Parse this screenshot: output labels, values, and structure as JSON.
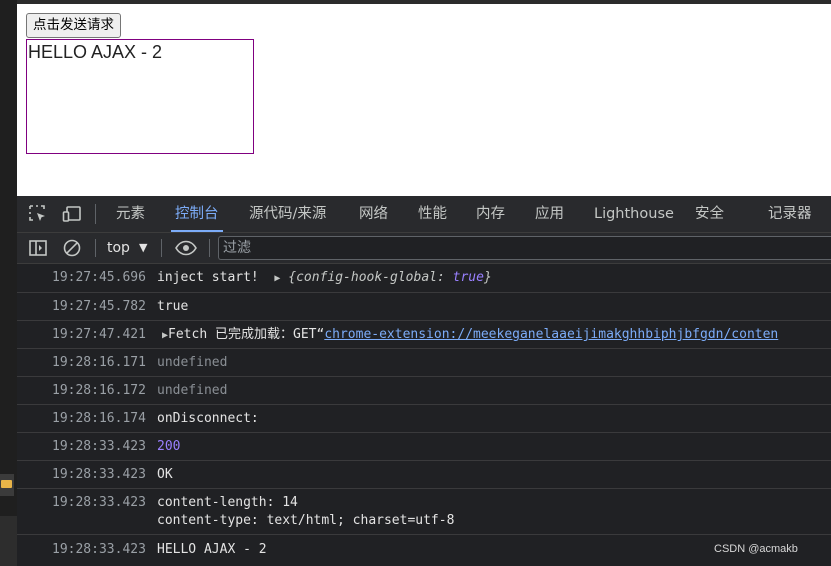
{
  "page": {
    "button_label": "点击发送请求",
    "result_text": "HELLO AJAX - 2"
  },
  "devtools": {
    "tabs": [
      "元素",
      "控制台",
      "源代码/来源",
      "网络",
      "性能",
      "内存",
      "应用",
      "Lighthouse",
      "安全",
      "记录器"
    ],
    "active_tab": "控制台",
    "context": "top",
    "filter_placeholder": "过滤",
    "icons": [
      "inspect-element-icon",
      "device-toolbar-icon",
      "sidebar-toggle-icon",
      "clear-console-icon",
      "live-expression-eye-icon",
      "context-dropdown-caret-icon",
      "expand-triangle-icon"
    ]
  },
  "console": {
    "rows": [
      {
        "time": "19:27:45.696",
        "text": "inject start!",
        "object_key": "config-hook-global",
        "object_value": "true"
      },
      {
        "time": "19:27:45.782",
        "text": "true"
      },
      {
        "time": "19:27:47.421",
        "prefix": "Fetch 已完成加载：GET“",
        "link": "chrome-extension://meekeganelaaeijimakghhbiphjbfgdn/conten"
      },
      {
        "time": "19:28:16.171",
        "text": "undefined"
      },
      {
        "time": "19:28:16.172",
        "text": "undefined"
      },
      {
        "time": "19:28:16.174",
        "text": "onDisconnect:"
      },
      {
        "time": "19:28:33.423",
        "text": "200"
      },
      {
        "time": "19:28:33.423",
        "text": "OK"
      },
      {
        "time": "19:28:33.423",
        "line1": "content-length: 14",
        "line2": "content-type: text/html; charset=utf-8"
      },
      {
        "time": "19:28:33.423",
        "text": "HELLO AJAX - 2"
      }
    ]
  },
  "watermark": "CSDN @acmakb",
  "colors": {
    "active_tab": "#7cacf8",
    "number": "#9980ff",
    "result_border": "#800080"
  }
}
